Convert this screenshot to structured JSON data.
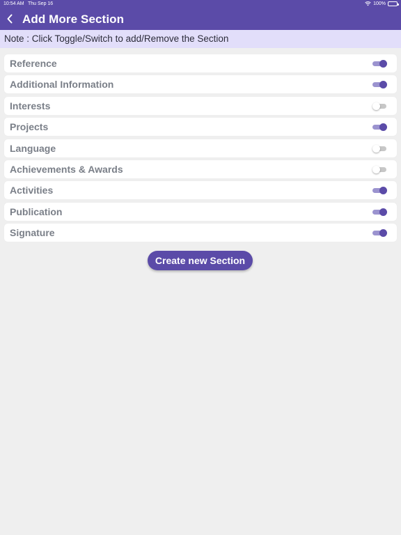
{
  "status_bar": {
    "time": "10:54 AM",
    "date": "Thu Sep 16",
    "battery": "100%"
  },
  "header": {
    "title": "Add More Section",
    "back_icon": "chevron-left-icon"
  },
  "note": "Note : Click Toggle/Switch to add/Remove the Section",
  "sections": [
    {
      "label": "Reference",
      "enabled": true
    },
    {
      "label": "Additional Information",
      "enabled": true
    },
    {
      "label": "Interests",
      "enabled": false
    },
    {
      "label": "Projects",
      "enabled": true
    },
    {
      "label": "Language",
      "enabled": false
    },
    {
      "label": "Achievements & Awards",
      "enabled": false
    },
    {
      "label": "Activities",
      "enabled": true
    },
    {
      "label": "Publication",
      "enabled": true
    },
    {
      "label": "Signature",
      "enabled": true
    }
  ],
  "create_button_label": "Create new Section",
  "colors": {
    "primary": "#5b4ba8",
    "note_bg": "#e2defa",
    "page_bg": "#efefef",
    "label_text": "#7a7f88"
  }
}
